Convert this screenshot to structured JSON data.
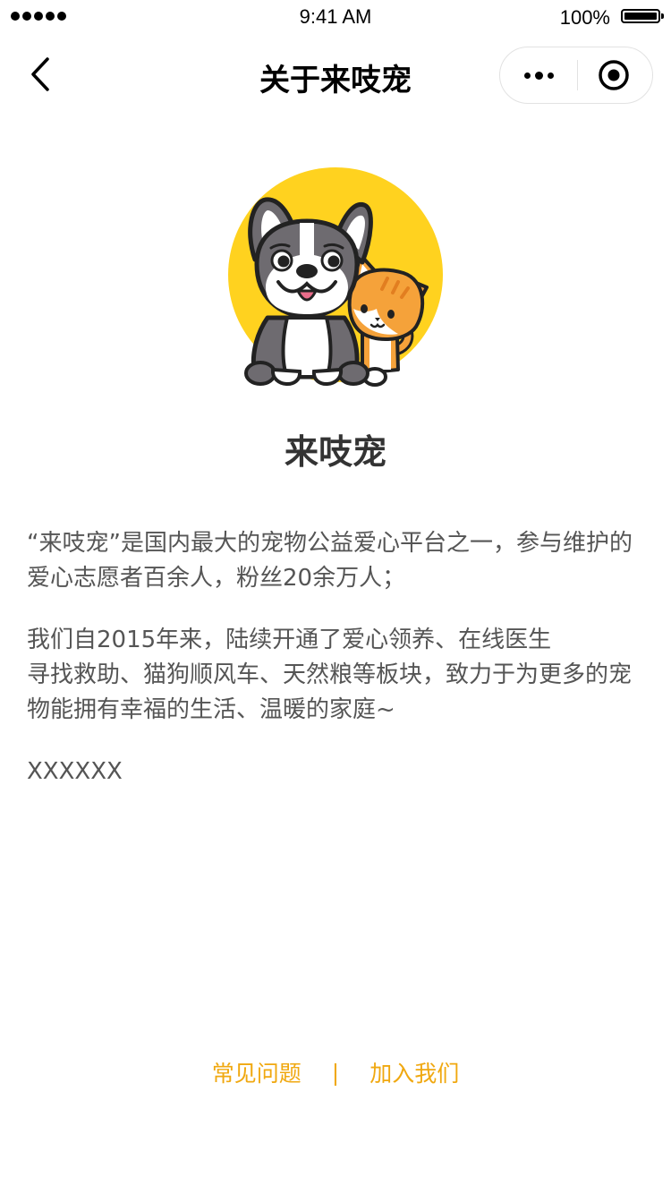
{
  "status_bar": {
    "time": "9:41 AM",
    "battery": "100%"
  },
  "nav": {
    "title": "关于来吱宠"
  },
  "logo": {
    "icon": "dog-and-cat-logo",
    "circle_color": "#FFD21F"
  },
  "app_name": "来吱宠",
  "description": {
    "paragraphs": [
      "“来吱宠”是国内最大的宠物公益爱心平台之一，参与维护的爱心志愿者百余人，粉丝20余万人；",
      "我们自2015年来，陆续开通了爱心领养、在线医生\n寻找救助、猫狗顺风车、天然粮等板块，致力于为更多的宠物能拥有幸福的生活、温暖的家庭~",
      "XXXXXX"
    ]
  },
  "footer": {
    "faq": "常见问题",
    "separator": "|",
    "join": "加入我们",
    "link_color": "#F0A810"
  }
}
